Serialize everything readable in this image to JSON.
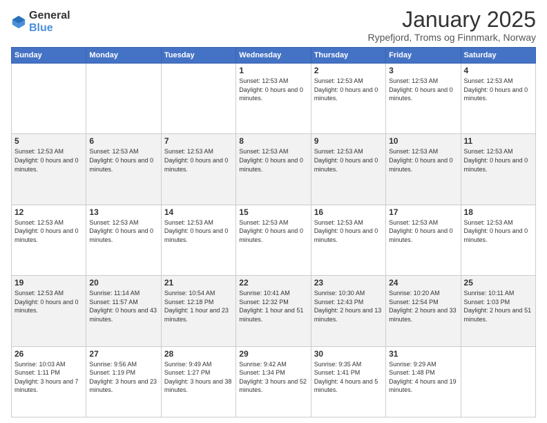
{
  "header": {
    "logo_general": "General",
    "logo_blue": "Blue",
    "month_title": "January 2025",
    "location": "Rypefjord, Troms og Finnmark, Norway"
  },
  "days_of_week": [
    "Sunday",
    "Monday",
    "Tuesday",
    "Wednesday",
    "Thursday",
    "Friday",
    "Saturday"
  ],
  "weeks": [
    [
      {
        "day": "",
        "info": ""
      },
      {
        "day": "",
        "info": ""
      },
      {
        "day": "",
        "info": ""
      },
      {
        "day": "1",
        "info": "Sunset: 12:53 AM\nDaylight: 0 hours and 0 minutes."
      },
      {
        "day": "2",
        "info": "Sunset: 12:53 AM\nDaylight: 0 hours and 0 minutes."
      },
      {
        "day": "3",
        "info": "Sunset: 12:53 AM\nDaylight: 0 hours and 0 minutes."
      },
      {
        "day": "4",
        "info": "Sunset: 12:53 AM\nDaylight: 0 hours and 0 minutes."
      }
    ],
    [
      {
        "day": "5",
        "info": "Sunset: 12:53 AM\nDaylight: 0 hours and 0 minutes."
      },
      {
        "day": "6",
        "info": "Sunset: 12:53 AM\nDaylight: 0 hours and 0 minutes."
      },
      {
        "day": "7",
        "info": "Sunset: 12:53 AM\nDaylight: 0 hours and 0 minutes."
      },
      {
        "day": "8",
        "info": "Sunset: 12:53 AM\nDaylight: 0 hours and 0 minutes."
      },
      {
        "day": "9",
        "info": "Sunset: 12:53 AM\nDaylight: 0 hours and 0 minutes."
      },
      {
        "day": "10",
        "info": "Sunset: 12:53 AM\nDaylight: 0 hours and 0 minutes."
      },
      {
        "day": "11",
        "info": "Sunset: 12:53 AM\nDaylight: 0 hours and 0 minutes."
      }
    ],
    [
      {
        "day": "12",
        "info": "Sunset: 12:53 AM\nDaylight: 0 hours and 0 minutes."
      },
      {
        "day": "13",
        "info": "Sunset: 12:53 AM\nDaylight: 0 hours and 0 minutes."
      },
      {
        "day": "14",
        "info": "Sunset: 12:53 AM\nDaylight: 0 hours and 0 minutes."
      },
      {
        "day": "15",
        "info": "Sunset: 12:53 AM\nDaylight: 0 hours and 0 minutes."
      },
      {
        "day": "16",
        "info": "Sunset: 12:53 AM\nDaylight: 0 hours and 0 minutes."
      },
      {
        "day": "17",
        "info": "Sunset: 12:53 AM\nDaylight: 0 hours and 0 minutes."
      },
      {
        "day": "18",
        "info": "Sunset: 12:53 AM\nDaylight: 0 hours and 0 minutes."
      }
    ],
    [
      {
        "day": "19",
        "info": "Sunset: 12:53 AM\nDaylight: 0 hours and 0 minutes."
      },
      {
        "day": "20",
        "info": "Sunrise: 11:14 AM\nSunset: 11:57 AM\nDaylight: 0 hours and 43 minutes."
      },
      {
        "day": "21",
        "info": "Sunrise: 10:54 AM\nSunset: 12:18 PM\nDaylight: 1 hour and 23 minutes."
      },
      {
        "day": "22",
        "info": "Sunrise: 10:41 AM\nSunset: 12:32 PM\nDaylight: 1 hour and 51 minutes."
      },
      {
        "day": "23",
        "info": "Sunrise: 10:30 AM\nSunset: 12:43 PM\nDaylight: 2 hours and 13 minutes."
      },
      {
        "day": "24",
        "info": "Sunrise: 10:20 AM\nSunset: 12:54 PM\nDaylight: 2 hours and 33 minutes."
      },
      {
        "day": "25",
        "info": "Sunrise: 10:11 AM\nSunset: 1:03 PM\nDaylight: 2 hours and 51 minutes."
      }
    ],
    [
      {
        "day": "26",
        "info": "Sunrise: 10:03 AM\nSunset: 1:11 PM\nDaylight: 3 hours and 7 minutes."
      },
      {
        "day": "27",
        "info": "Sunrise: 9:56 AM\nSunset: 1:19 PM\nDaylight: 3 hours and 23 minutes."
      },
      {
        "day": "28",
        "info": "Sunrise: 9:49 AM\nSunset: 1:27 PM\nDaylight: 3 hours and 38 minutes."
      },
      {
        "day": "29",
        "info": "Sunrise: 9:42 AM\nSunset: 1:34 PM\nDaylight: 3 hours and 52 minutes."
      },
      {
        "day": "30",
        "info": "Sunrise: 9:35 AM\nSunset: 1:41 PM\nDaylight: 4 hours and 5 minutes."
      },
      {
        "day": "31",
        "info": "Sunrise: 9:29 AM\nSunset: 1:48 PM\nDaylight: 4 hours and 19 minutes."
      },
      {
        "day": "",
        "info": ""
      }
    ]
  ]
}
